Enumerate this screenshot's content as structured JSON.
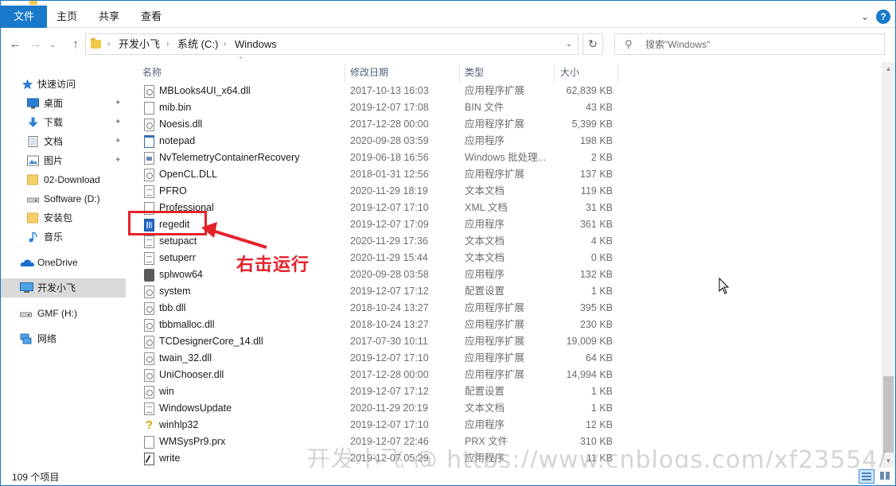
{
  "ribbon": {
    "tabs": [
      "文件",
      "主页",
      "共享",
      "查看"
    ]
  },
  "nav": {
    "breadcrumbs": [
      "开发小飞",
      "系统 (C:)",
      "Windows"
    ],
    "search_placeholder": "搜索\"Windows\""
  },
  "sidebar": {
    "quick_access": "快速访问",
    "pinned": [
      {
        "label": "桌面",
        "icon": "desktop-icon",
        "pinned": true
      },
      {
        "label": "下载",
        "icon": "download-icon",
        "pinned": true
      },
      {
        "label": "文档",
        "icon": "documents-icon",
        "pinned": true
      },
      {
        "label": "图片",
        "icon": "pictures-icon",
        "pinned": true
      },
      {
        "label": "02-Download",
        "icon": "folder-icon",
        "pinned": false
      },
      {
        "label": "Software (D:)",
        "icon": "drive-icon",
        "pinned": false
      },
      {
        "label": "安装包",
        "icon": "folder-icon",
        "pinned": false
      },
      {
        "label": "音乐",
        "icon": "music-icon",
        "pinned": false
      }
    ],
    "onedrive": "OneDrive",
    "this_pc": "开发小飞",
    "gmf": "GMF (H:)",
    "network": "网络"
  },
  "columns": {
    "name": "名称",
    "date": "修改日期",
    "type": "类型",
    "size": "大小"
  },
  "files": [
    {
      "name": "MBLooks4UI_x64.dll",
      "date": "2017-10-13 16:03",
      "type": "应用程序扩展",
      "size": "62,839 KB",
      "icon": "gear"
    },
    {
      "name": "mib.bin",
      "date": "2019-12-07 17:08",
      "type": "BIN 文件",
      "size": "43 KB",
      "icon": "blank"
    },
    {
      "name": "Noesis.dll",
      "date": "2017-12-28 00:00",
      "type": "应用程序扩展",
      "size": "5,399 KB",
      "icon": "gear"
    },
    {
      "name": "notepad",
      "date": "2020-09-28 03:59",
      "type": "应用程序",
      "size": "198 KB",
      "icon": "app-note"
    },
    {
      "name": "NvTelemetryContainerRecovery",
      "date": "2019-06-18 16:56",
      "type": "Windows 批处理...",
      "size": "2 KB",
      "icon": "bat"
    },
    {
      "name": "OpenCL.DLL",
      "date": "2018-01-31 12:56",
      "type": "应用程序扩展",
      "size": "137 KB",
      "icon": "gear"
    },
    {
      "name": "PFRO",
      "date": "2020-11-29 18:19",
      "type": "文本文档",
      "size": "119 KB",
      "icon": "doc"
    },
    {
      "name": "Professional",
      "date": "2019-12-07 17:10",
      "type": "XML 文档",
      "size": "31 KB",
      "icon": "blank"
    },
    {
      "name": "regedit",
      "date": "2019-12-07 17:09",
      "type": "应用程序",
      "size": "361 KB",
      "icon": "regedit"
    },
    {
      "name": "setupact",
      "date": "2020-11-29 17:36",
      "type": "文本文档",
      "size": "4 KB",
      "icon": "doc"
    },
    {
      "name": "setuperr",
      "date": "2020-11-29 15:44",
      "type": "文本文档",
      "size": "0 KB",
      "icon": "doc"
    },
    {
      "name": "splwow64",
      "date": "2020-09-28 03:58",
      "type": "应用程序",
      "size": "132 KB",
      "icon": "printer"
    },
    {
      "name": "system",
      "date": "2019-12-07 17:12",
      "type": "配置设置",
      "size": "1 KB",
      "icon": "gear"
    },
    {
      "name": "tbb.dll",
      "date": "2018-10-24 13:27",
      "type": "应用程序扩展",
      "size": "395 KB",
      "icon": "gear"
    },
    {
      "name": "tbbmalloc.dll",
      "date": "2018-10-24 13:27",
      "type": "应用程序扩展",
      "size": "230 KB",
      "icon": "gear"
    },
    {
      "name": "TCDesignerCore_14.dll",
      "date": "2017-07-30 10:11",
      "type": "应用程序扩展",
      "size": "19,009 KB",
      "icon": "gear"
    },
    {
      "name": "twain_32.dll",
      "date": "2019-12-07 17:10",
      "type": "应用程序扩展",
      "size": "64 KB",
      "icon": "gear"
    },
    {
      "name": "UniChooser.dll",
      "date": "2017-12-28 00:00",
      "type": "应用程序扩展",
      "size": "14,994 KB",
      "icon": "gear"
    },
    {
      "name": "win",
      "date": "2019-12-07 17:12",
      "type": "配置设置",
      "size": "1 KB",
      "icon": "gear"
    },
    {
      "name": "WindowsUpdate",
      "date": "2020-11-29 20:19",
      "type": "文本文档",
      "size": "1 KB",
      "icon": "doc"
    },
    {
      "name": "winhlp32",
      "date": "2019-12-07 17:10",
      "type": "应用程序",
      "size": "12 KB",
      "icon": "help"
    },
    {
      "name": "WMSysPr9.prx",
      "date": "2019-12-07 22:46",
      "type": "PRX 文件",
      "size": "310 KB",
      "icon": "blank"
    },
    {
      "name": "write",
      "date": "2019-12-07 05:29",
      "type": "应用程序",
      "size": "11 KB",
      "icon": "write"
    }
  ],
  "annotation": "右击运行",
  "status": {
    "item_count": "109 个项目"
  },
  "watermark": "开发小飞 @ https://www.cnblogs.com/xf23554/",
  "colors": {
    "accent": "#1979ca",
    "annotation_red": "#e5212a"
  }
}
